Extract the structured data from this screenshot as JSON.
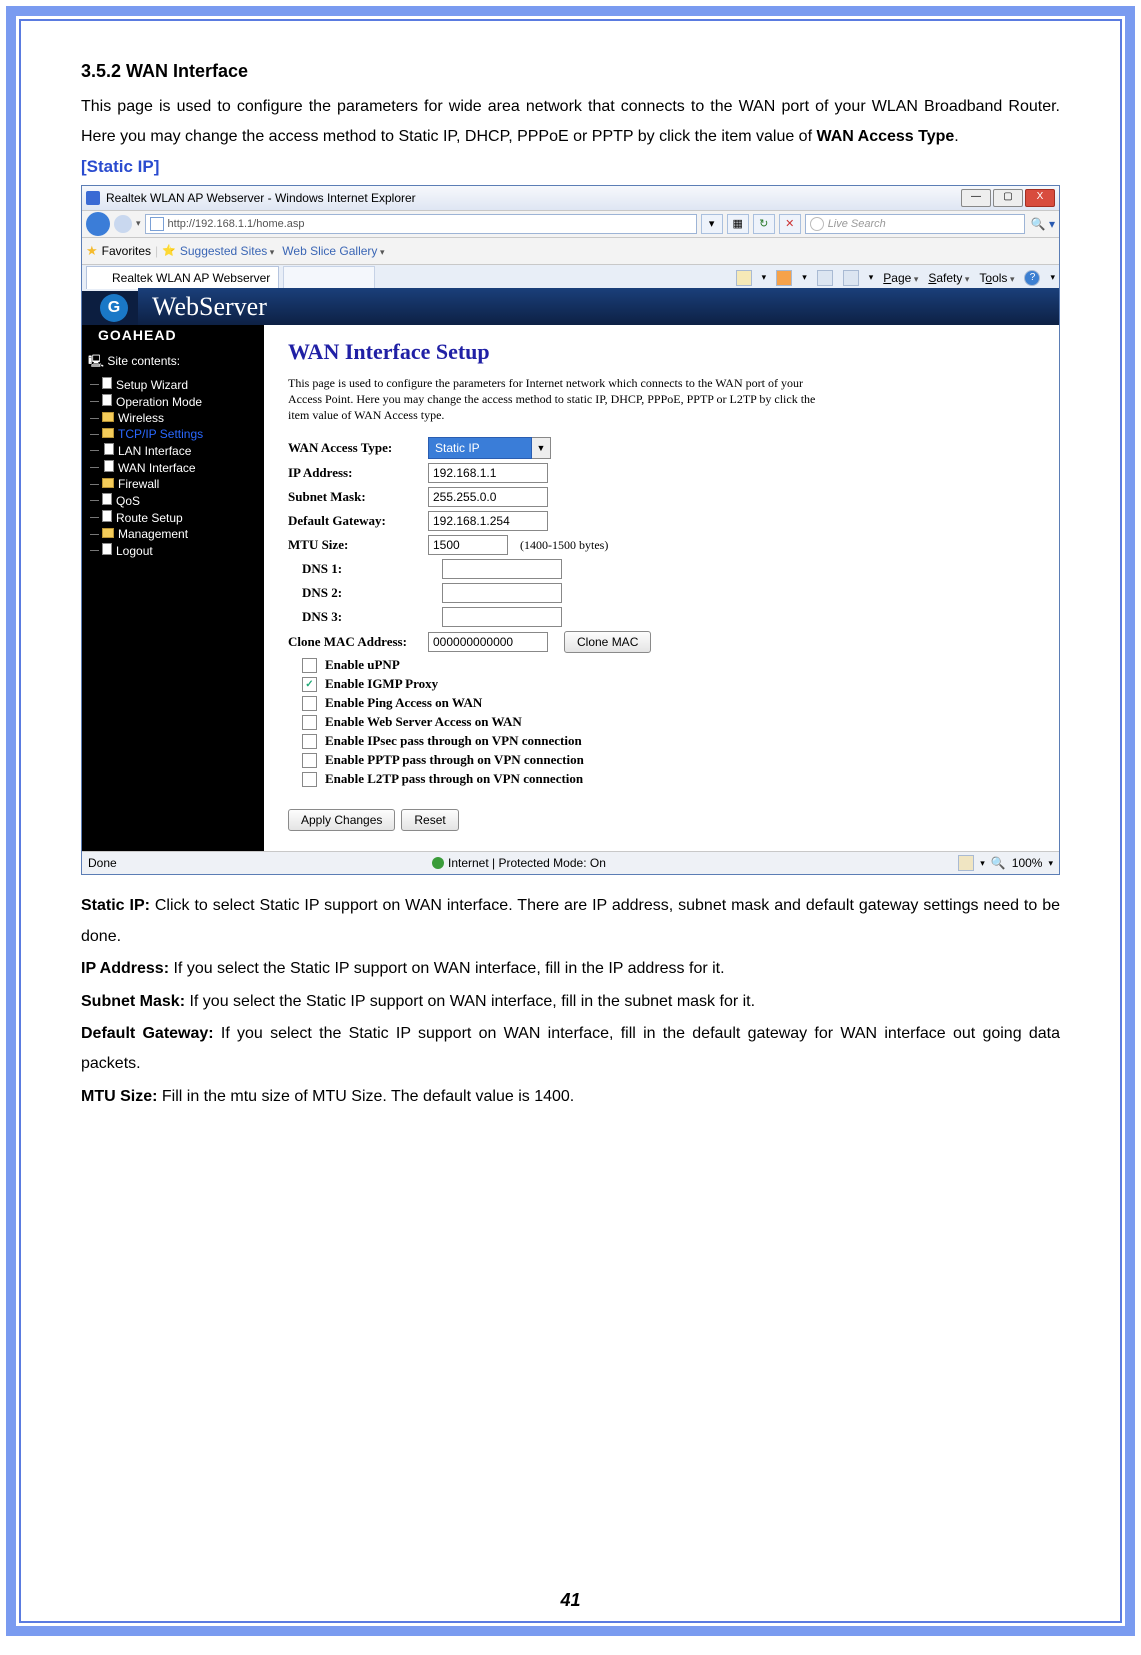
{
  "doc": {
    "section_title": "3.5.2 WAN Interface",
    "intro": "This page is used to configure the parameters for wide area network that connects to the WAN port of your WLAN Broadband Router. Here you may change the access method to Static IP, DHCP, PPPoE or PPTP by click the item value of WAN Access Type.",
    "intro_bold_tail": "WAN Access Type",
    "static_ip_tag": "[Static IP]",
    "defs": {
      "static_ip_b": "Static IP:",
      "static_ip_t": " Click to select Static IP support on WAN interface. There are IP address, subnet mask and default gateway settings need to be done.",
      "ip_b": "IP Address:",
      "ip_t": " If you select the Static IP support on WAN interface, fill in the IP address for it.",
      "subnet_b": "Subnet Mask:",
      "subnet_t": " If you select the Static IP support on WAN interface, fill in the subnet mask for it.",
      "gw_b": "Default Gateway:",
      "gw_t": " If you select the Static IP support on WAN interface, fill in the default gateway for WAN interface out going data packets.",
      "mtu_b": "MTU Size:",
      "mtu_t": " Fill in the mtu size of MTU Size. The default value is 1400."
    },
    "page_number": "41"
  },
  "ie": {
    "title": "Realtek WLAN AP Webserver - Windows Internet Explorer",
    "url": "http://192.168.1.1/home.asp",
    "search_placeholder": "Live Search",
    "favorites_label": "Favorites",
    "suggested_sites": "Suggested Sites",
    "web_slice": "Web Slice Gallery",
    "tab_title": "Realtek WLAN AP Webserver",
    "menus": {
      "page": "Page",
      "safety": "Safety",
      "tools": "Tools"
    },
    "status_left": "Done",
    "status_mid": "Internet | Protected Mode: On",
    "zoom": "100%"
  },
  "app": {
    "brand_top": "WebServer",
    "brand_go": "GOAHEAD",
    "tree_header": "Site contents:",
    "tree": {
      "setup_wizard": "Setup Wizard",
      "op_mode": "Operation Mode",
      "wireless": "Wireless",
      "tcpip": "TCP/IP Settings",
      "lan_if": "LAN Interface",
      "wan_if": "WAN Interface",
      "firewall": "Firewall",
      "qos": "QoS",
      "route": "Route Setup",
      "mgmt": "Management",
      "logout": "Logout"
    },
    "form": {
      "title": "WAN Interface Setup",
      "desc": "This page is used to configure the parameters for Internet network which connects to the WAN port of your Access Point. Here you may change the access method to static IP, DHCP, PPPoE, PPTP or L2TP by click the item value of WAN Access type.",
      "labels": {
        "wan_type": "WAN Access Type:",
        "ip": "IP Address:",
        "subnet": "Subnet Mask:",
        "gw": "Default Gateway:",
        "mtu": "MTU Size:",
        "dns1": "DNS 1:",
        "dns2": "DNS 2:",
        "dns3": "DNS 3:",
        "clone": "Clone MAC Address:"
      },
      "values": {
        "wan_type_sel": "Static IP",
        "ip": "192.168.1.1",
        "subnet": "255.255.0.0",
        "gw": "192.168.1.254",
        "mtu": "1500",
        "mtu_hint": "(1400-1500 bytes)",
        "clone": "000000000000"
      },
      "checks": {
        "upnp": "Enable uPNP",
        "igmp": "Enable IGMP Proxy",
        "ping": "Enable Ping Access on WAN",
        "webs": "Enable Web Server Access on WAN",
        "ipsec": "Enable IPsec pass through on VPN connection",
        "pptp": "Enable PPTP pass through on VPN connection",
        "l2tp": "Enable L2TP pass through on VPN connection"
      },
      "buttons": {
        "clone_mac": "Clone MAC",
        "apply": "Apply Changes",
        "reset": "Reset"
      }
    }
  }
}
